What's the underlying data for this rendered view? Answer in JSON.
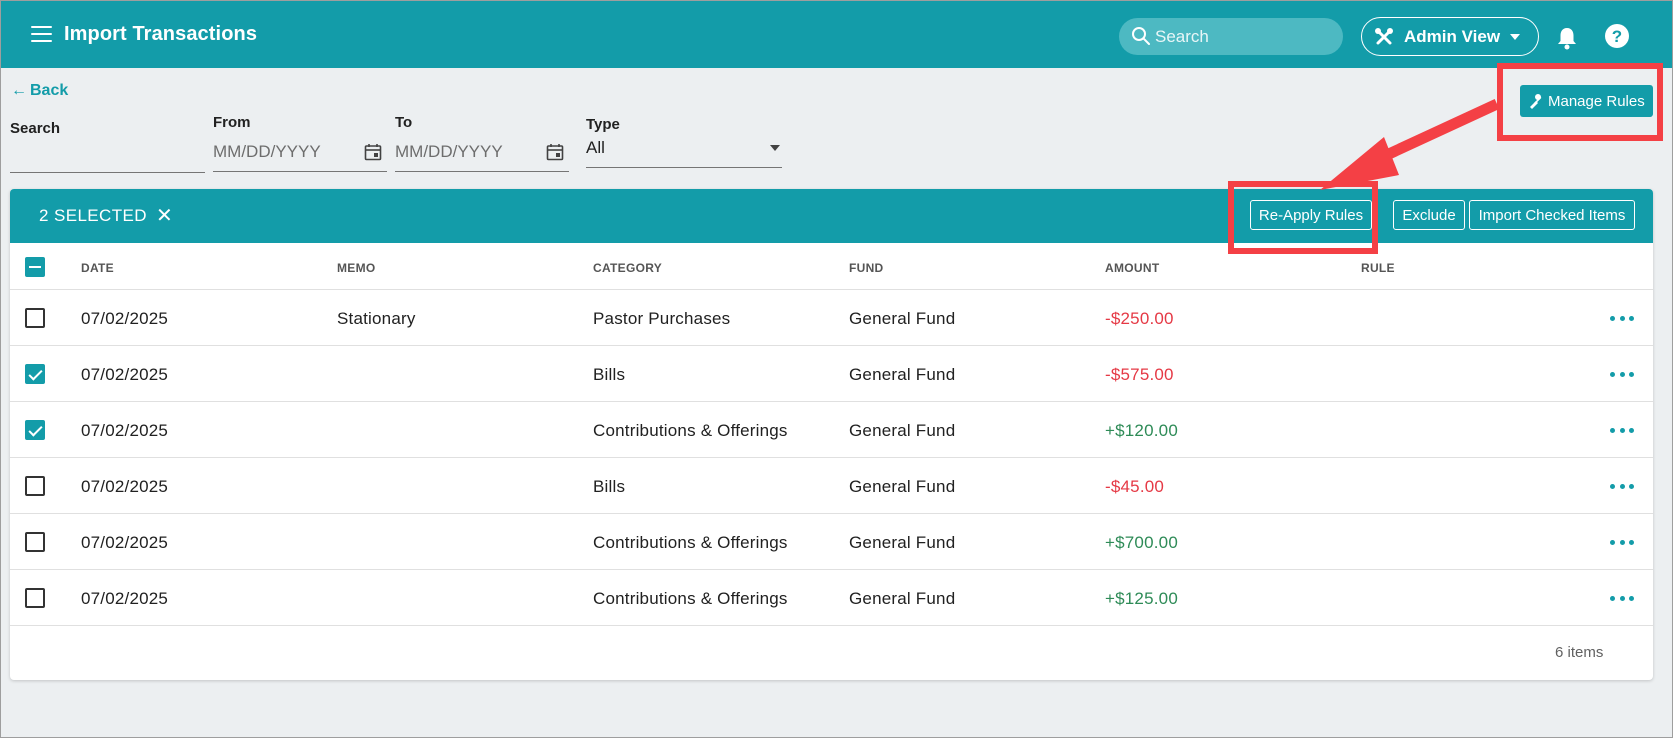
{
  "header": {
    "title": "Import Transactions",
    "search_placeholder": "Search",
    "admin_view_label": "Admin View"
  },
  "filters": {
    "back_label": "Back",
    "search_label": "Search",
    "from_label": "From",
    "from_placeholder": "MM/DD/YYYY",
    "to_label": "To",
    "to_placeholder": "MM/DD/YYYY",
    "type_label": "Type",
    "type_value": "All"
  },
  "manage_rules_label": "Manage Rules",
  "toolbar": {
    "selected_text": "2 SELECTED",
    "reapply_label": "Re-Apply Rules",
    "exclude_label": "Exclude",
    "import_label": "Import Checked Items"
  },
  "table": {
    "columns": [
      "DATE",
      "MEMO",
      "CATEGORY",
      "FUND",
      "AMOUNT",
      "RULE"
    ],
    "rows": [
      {
        "date": "07/02/2025",
        "memo": "Stationary",
        "category": "Pastor Purchases",
        "fund": "General Fund",
        "amount": "-$250.00",
        "rule": "",
        "checked": false
      },
      {
        "date": "07/02/2025",
        "memo": "",
        "category": "Bills",
        "fund": "General Fund",
        "amount": "-$575.00",
        "rule": "",
        "checked": true
      },
      {
        "date": "07/02/2025",
        "memo": "",
        "category": "Contributions & Offerings",
        "fund": "General Fund",
        "amount": "+$120.00",
        "rule": "",
        "checked": true
      },
      {
        "date": "07/02/2025",
        "memo": "",
        "category": "Bills",
        "fund": "General Fund",
        "amount": "-$45.00",
        "rule": "",
        "checked": false
      },
      {
        "date": "07/02/2025",
        "memo": "",
        "category": "Contributions & Offerings",
        "fund": "General Fund",
        "amount": "+$700.00",
        "rule": "",
        "checked": false
      },
      {
        "date": "07/02/2025",
        "memo": "",
        "category": "Contributions & Offerings",
        "fund": "General Fund",
        "amount": "+$125.00",
        "rule": "",
        "checked": false
      }
    ],
    "items_count": "6 items"
  },
  "colors": {
    "primary": "#139ca9",
    "negative": "#e53945",
    "positive": "#2e8b57",
    "annotation": "#f44045"
  },
  "icons": {
    "menu": "hamburger-icon",
    "search": "search-icon",
    "admin": "tools-icon",
    "notifications": "bell-icon",
    "help": "help-icon",
    "calendar": "calendar-icon",
    "rules": "rules-icon",
    "row_actions": "more-horizontal-icon"
  }
}
